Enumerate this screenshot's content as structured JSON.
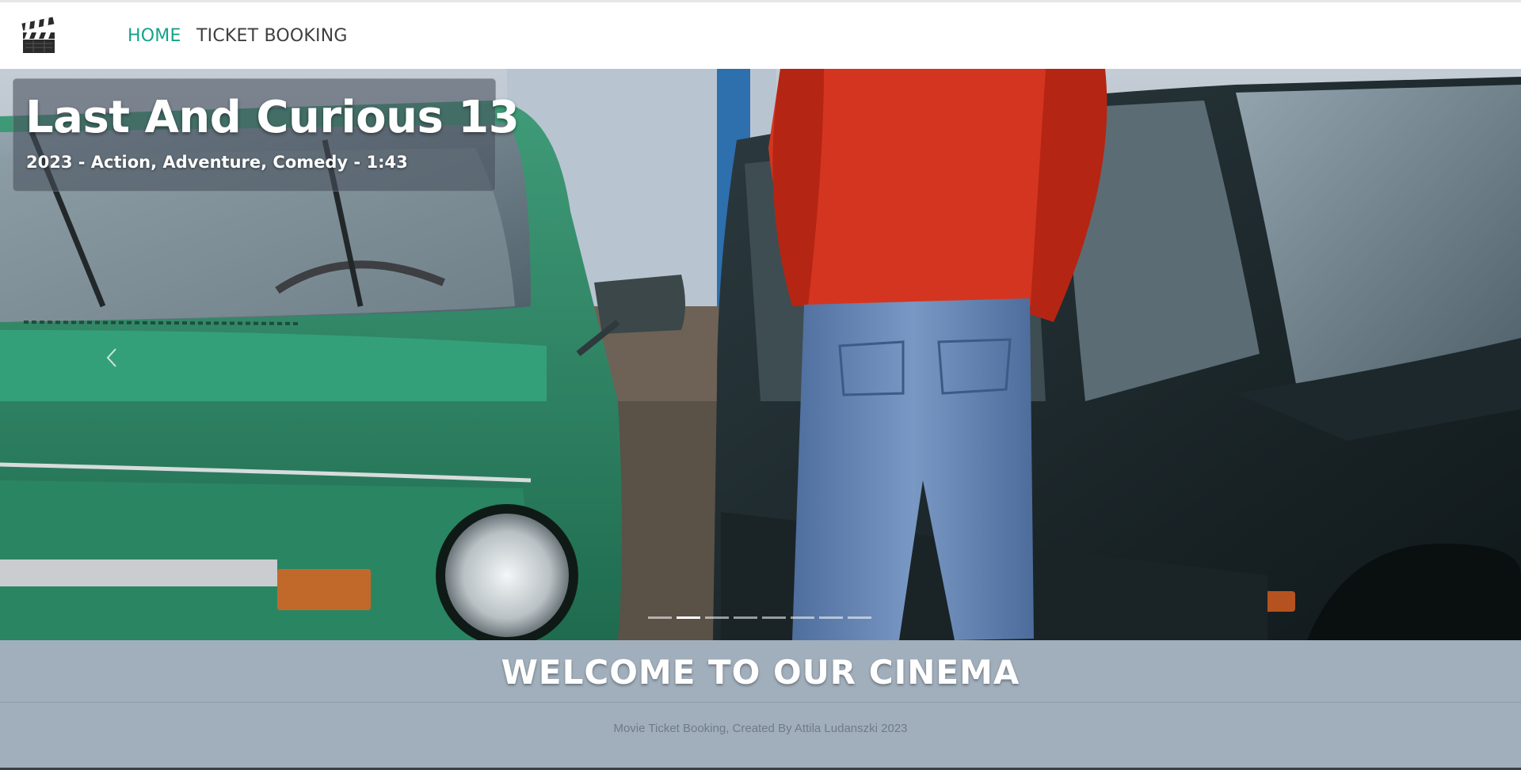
{
  "nav": {
    "logo_icon": "clapperboard-icon",
    "links": [
      {
        "label": "HOME",
        "active": true
      },
      {
        "label": "TICKET BOOKING",
        "active": false
      }
    ],
    "accent_color": "#14a38a"
  },
  "carousel": {
    "slide": {
      "title": "Last And Curious 13",
      "subtitle": "2023 - Action, Adventure, Comedy - 1:43"
    },
    "indicator_count": 8,
    "active_index": 1,
    "prev_icon": "chevron-left-icon"
  },
  "welcome": {
    "heading": "WELCOME TO OUR CINEMA",
    "footer": "Movie Ticket Booking, Created By Attila Ludanszki 2023"
  }
}
